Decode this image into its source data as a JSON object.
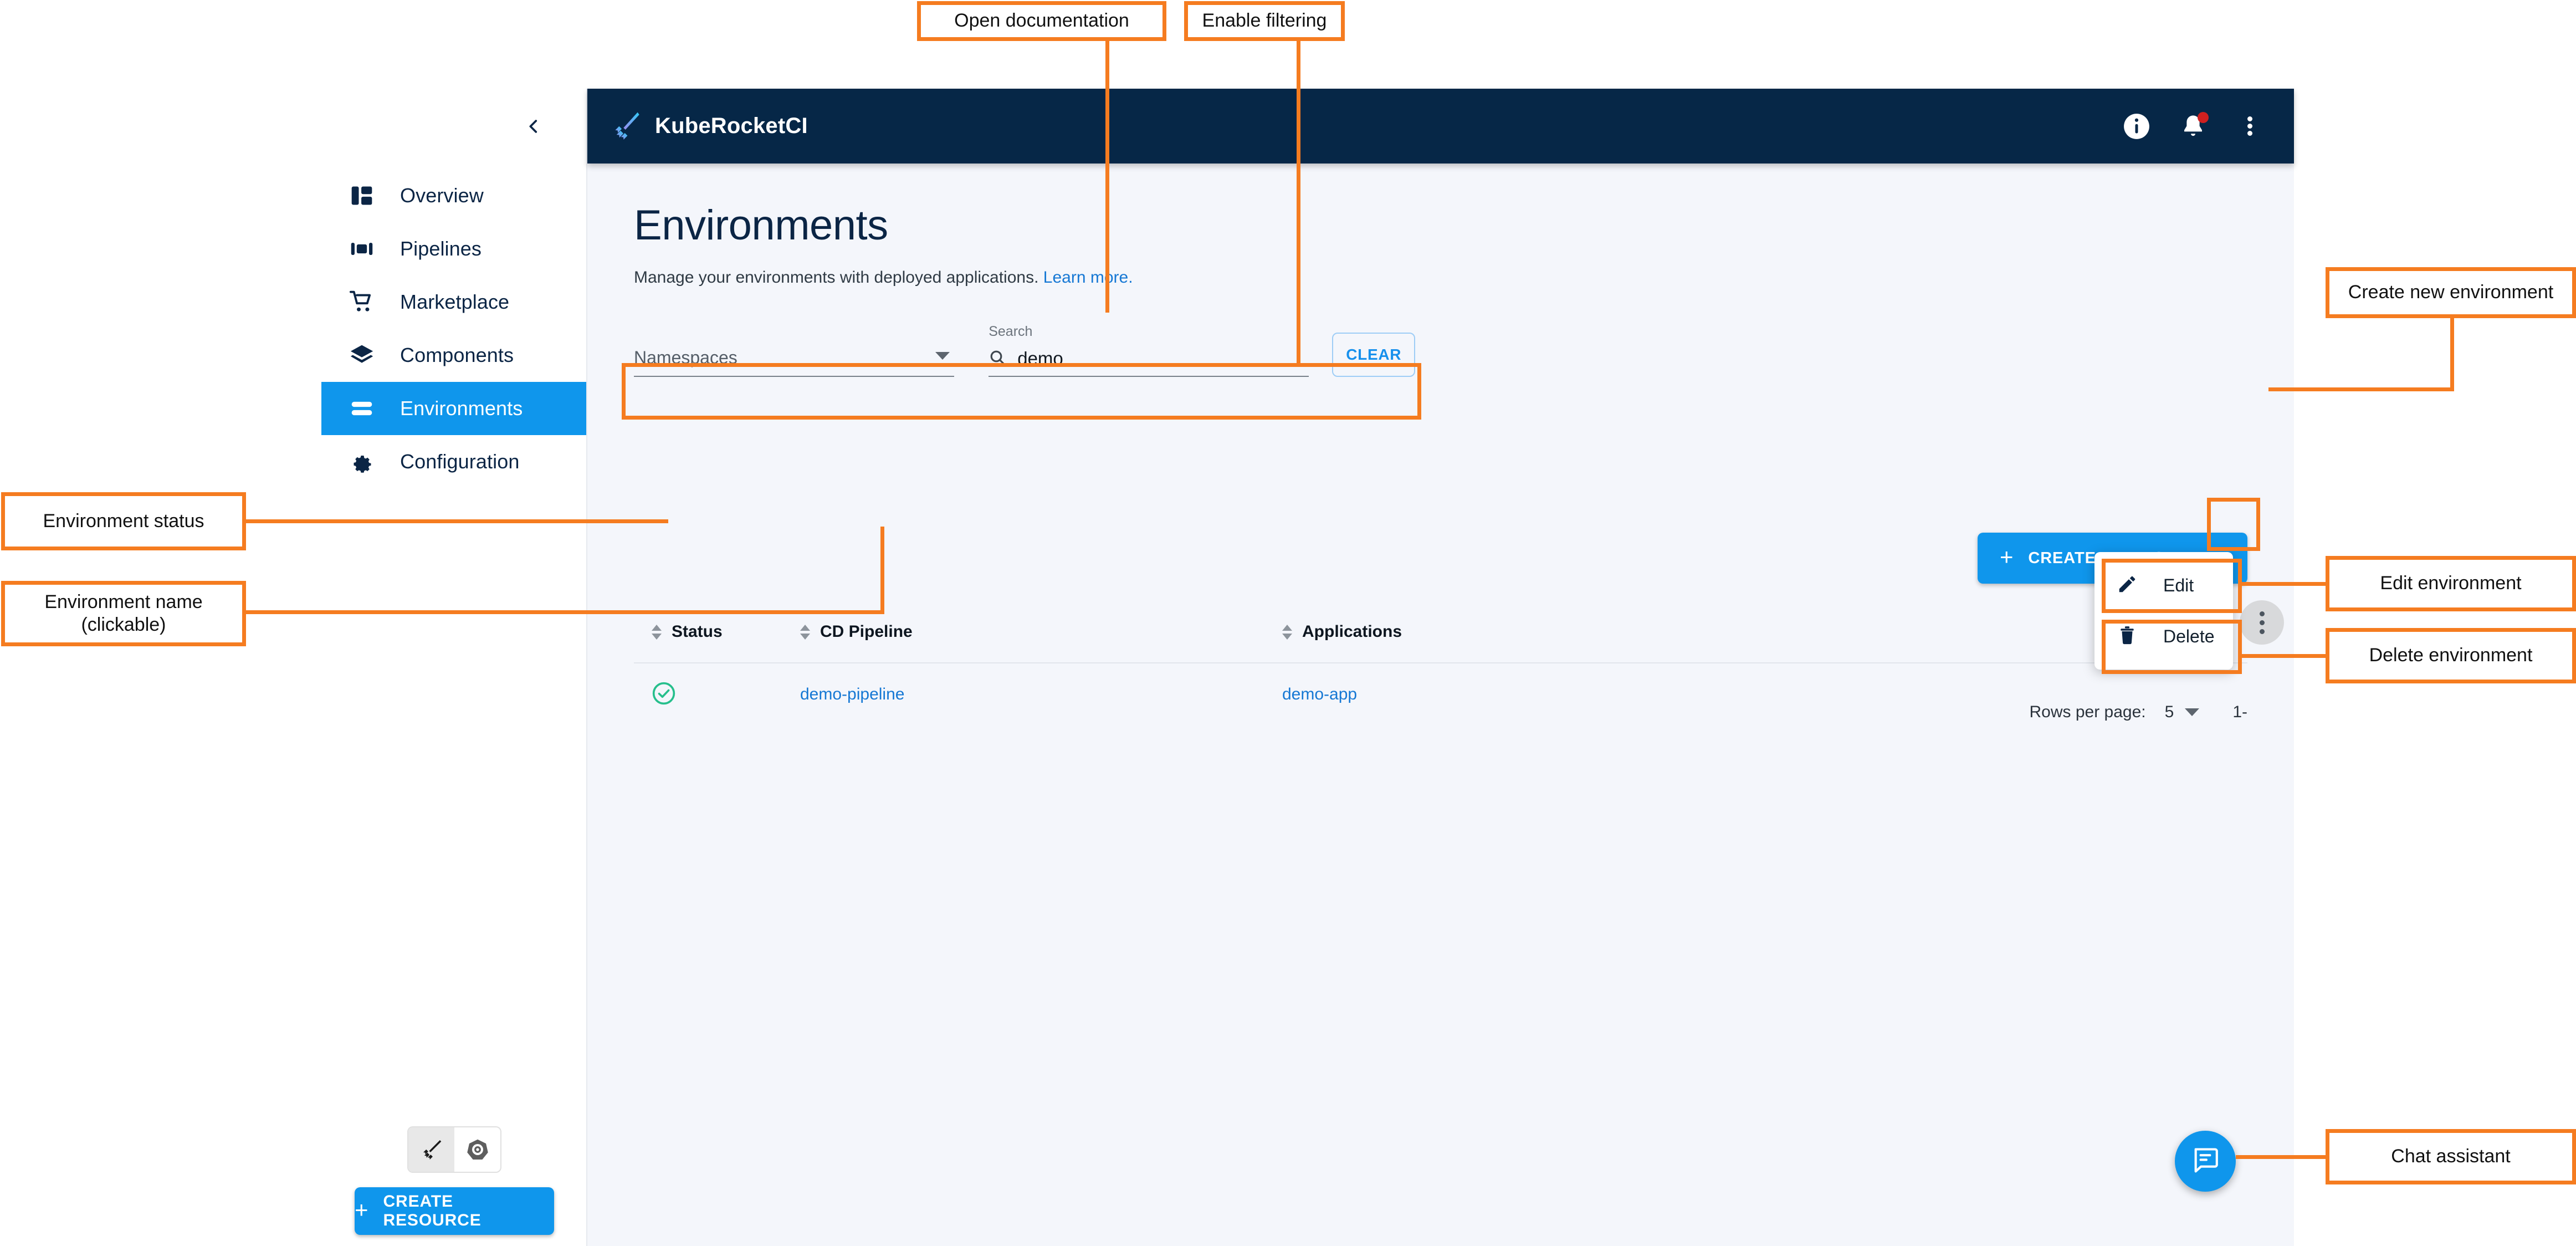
{
  "app": {
    "brand_name": "KubeRocketCI",
    "brand_logo_icon": "rocket-feather-logo",
    "collapse_icon": "chevron-left-icon",
    "topbar_icons": [
      {
        "name": "info-icon",
        "glyph": "i"
      },
      {
        "name": "notifications-bell-icon",
        "has_badge": true
      },
      {
        "name": "topbar-overflow-menu-icon"
      }
    ]
  },
  "sidebar": {
    "items": [
      {
        "label": "Overview",
        "icon": "dashboard-icon",
        "active": false
      },
      {
        "label": "Pipelines",
        "icon": "pipelines-icon",
        "active": false
      },
      {
        "label": "Marketplace",
        "icon": "cart-icon",
        "active": false
      },
      {
        "label": "Components",
        "icon": "layers-icon",
        "active": false
      },
      {
        "label": "Environments",
        "icon": "environments-icon",
        "active": true
      },
      {
        "label": "Configuration",
        "icon": "gear-icon",
        "active": false
      }
    ],
    "view_toggle": [
      {
        "name": "kuberocket-view-icon",
        "selected": true
      },
      {
        "name": "kubernetes-view-icon",
        "selected": false
      }
    ],
    "create_resource_label": "CREATE RESOURCE",
    "create_resource_plus": "+"
  },
  "page": {
    "title": "Environments",
    "subtitle_text": "Manage your environments with deployed applications.",
    "subtitle_link": "Learn more.",
    "create_environment_label": "CREATE ENVIRONMENT",
    "create_environment_plus": "+"
  },
  "filters": {
    "namespace_placeholder": "Namespaces",
    "search_label": "Search",
    "search_value": "demo",
    "search_icon": "search-icon",
    "clear_label": "CLEAR"
  },
  "table": {
    "columns": [
      {
        "key": "status",
        "label": "Status"
      },
      {
        "key": "cd_pipeline",
        "label": "CD Pipeline"
      },
      {
        "key": "applications",
        "label": "Applications"
      }
    ],
    "rows": [
      {
        "status_icon": "check-circle-icon",
        "status_color": "#26bf8c",
        "cd_pipeline": "demo-pipeline",
        "applications": "demo-app",
        "row_menu_icon": "row-overflow-menu-icon"
      }
    ]
  },
  "pagination": {
    "rows_per_page_label": "Rows per page:",
    "rows_per_page_value": "5",
    "range_label": "1-"
  },
  "context_menu": {
    "items": [
      {
        "label": "Edit",
        "icon": "pencil-icon"
      },
      {
        "label": "Delete",
        "icon": "trash-icon"
      }
    ]
  },
  "chat": {
    "icon": "chat-bubble-icon"
  },
  "annotations": [
    {
      "id": "open-documentation",
      "text": "Open documentation"
    },
    {
      "id": "enable-filtering",
      "text": "Enable filtering"
    },
    {
      "id": "create-new-environment",
      "text": "Create new environment"
    },
    {
      "id": "environment-status",
      "text": "Environment status"
    },
    {
      "id": "environment-name",
      "text": "Environment name\n(clickable)"
    },
    {
      "id": "edit-environment",
      "text": "Edit environment"
    },
    {
      "id": "delete-environment",
      "text": "Delete environment"
    },
    {
      "id": "chat-assistant",
      "text": "Chat assistant"
    }
  ],
  "colors": {
    "brand_navy": "#062747",
    "accent_blue": "#0f96ec",
    "link_blue": "#1678d4",
    "annotation_orange": "#f57c20",
    "status_green": "#26bf8c",
    "content_bg": "#f4f6fb"
  }
}
